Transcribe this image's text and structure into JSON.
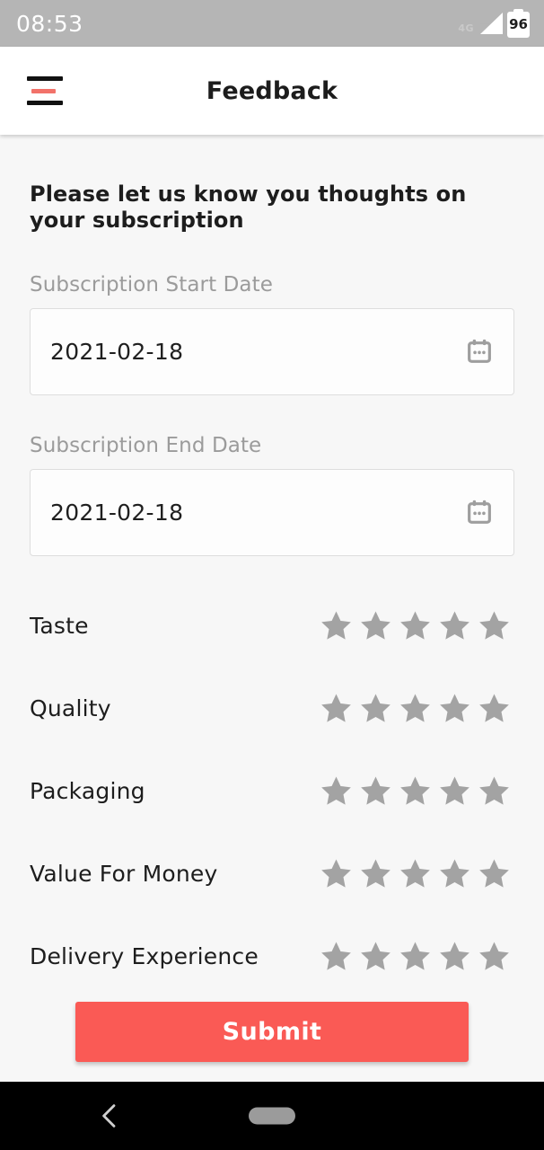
{
  "status_bar": {
    "time": "08:53",
    "network_label": "4G",
    "battery_level": "96",
    "background_color": "#b5b5b5"
  },
  "app_bar": {
    "title": "Feedback",
    "menu_icon": "hamburger-menu-icon",
    "accent_color": "#f2726a"
  },
  "form": {
    "heading": "Please let us know you thoughts on your subscription",
    "start_date": {
      "label": "Subscription Start Date",
      "value": "2021-02-18",
      "icon": "calendar-icon"
    },
    "end_date": {
      "label": "Subscription End Date",
      "value": "2021-02-18",
      "icon": "calendar-icon"
    },
    "ratings": [
      {
        "label": "Taste",
        "value": 0,
        "max": 5
      },
      {
        "label": "Quality",
        "value": 0,
        "max": 5
      },
      {
        "label": "Packaging",
        "value": 0,
        "max": 5
      },
      {
        "label": "Value For Money",
        "value": 0,
        "max": 5
      },
      {
        "label": "Delivery Experience",
        "value": 0,
        "max": 5
      }
    ],
    "star_color": "#a3a3a3",
    "submit_label": "Submit",
    "submit_color": "#fa5a55"
  },
  "nav_bar": {
    "back_icon": "chevron-left-icon",
    "home_icon": "home-pill-indicator"
  }
}
